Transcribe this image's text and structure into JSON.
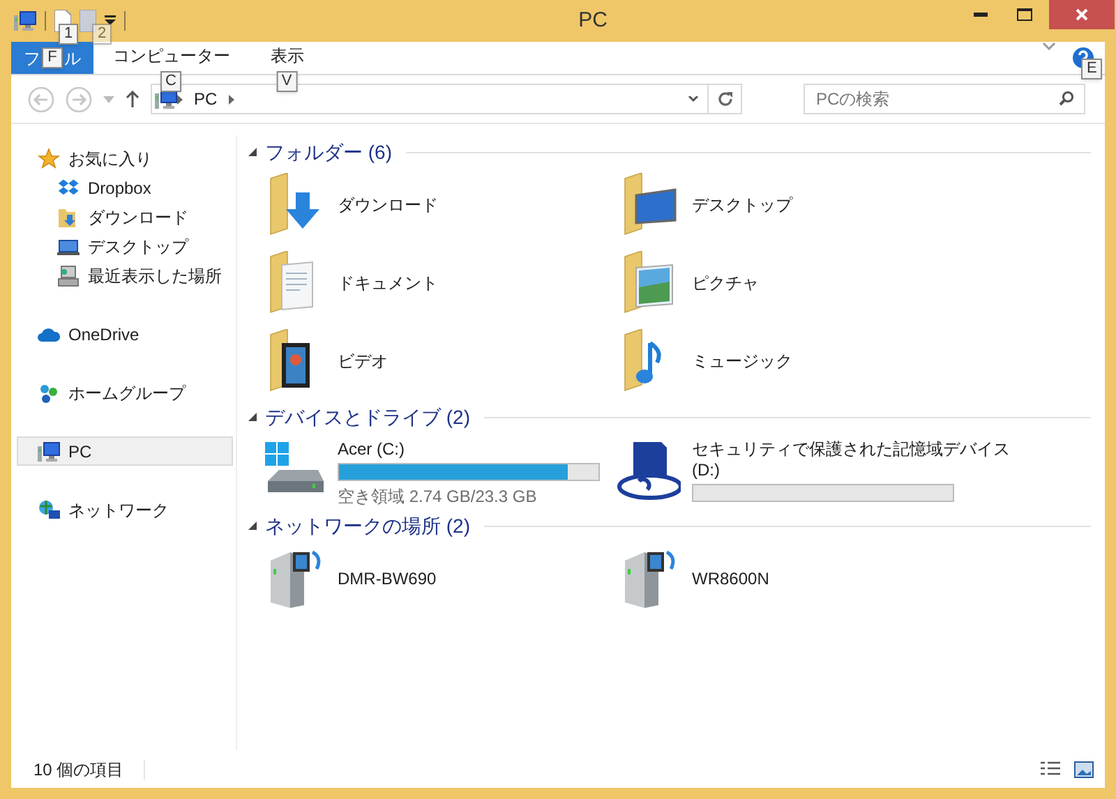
{
  "window": {
    "title": "PC"
  },
  "quick_access": {
    "keytips": [
      "1",
      "2"
    ]
  },
  "ribbon": {
    "tabs": [
      {
        "kind": "file",
        "label_start": "フ",
        "keytip": "F",
        "label_end": "ル",
        "selected": false
      },
      {
        "kind": "tab",
        "label": "コンピューター",
        "keytip": "C",
        "selected": false
      },
      {
        "kind": "tab",
        "label": "表示",
        "keytip": "V",
        "selected": false
      }
    ],
    "help_keytip": "E"
  },
  "address_bar": {
    "crumbs": [
      "PC"
    ]
  },
  "search": {
    "placeholder": "PCの検索"
  },
  "sidebar": {
    "groups": [
      {
        "label": "お気に入り",
        "selected": false,
        "children": [
          {
            "label": "Dropbox",
            "selected": false
          },
          {
            "label": "ダウンロード",
            "selected": false
          },
          {
            "label": "デスクトップ",
            "selected": false
          },
          {
            "label": "最近表示した場所",
            "selected": false
          }
        ]
      },
      {
        "label": "OneDrive",
        "selected": false
      },
      {
        "label": "ホームグループ",
        "selected": false
      },
      {
        "label": "PC",
        "selected": true
      },
      {
        "label": "ネットワーク",
        "selected": false
      }
    ]
  },
  "sections": [
    {
      "title": "フォルダー (6)",
      "expanded": true,
      "items": [
        {
          "kind": "folder",
          "label": "ダウンロード"
        },
        {
          "kind": "folder",
          "label": "デスクトップ"
        },
        {
          "kind": "folder",
          "label": "ドキュメント"
        },
        {
          "kind": "folder",
          "label": "ピクチャ"
        },
        {
          "kind": "folder",
          "label": "ビデオ"
        },
        {
          "kind": "folder",
          "label": "ミュージック"
        }
      ]
    },
    {
      "title": "デバイスとドライブ (2)",
      "expanded": true,
      "items": [
        {
          "kind": "drive",
          "label": "Acer (C:)",
          "level": 0.88,
          "free": "空き領域 2.74 GB/23.3 GB"
        },
        {
          "kind": "drive",
          "label": "セキュリティで保護された記憶域デバイス",
          "label_2": "(D:)",
          "level": 0
        }
      ]
    },
    {
      "title": "ネットワークの場所 (2)",
      "expanded": true,
      "items": [
        {
          "kind": "media",
          "label": "DMR-BW690"
        },
        {
          "kind": "media",
          "label": "WR8600N"
        }
      ]
    }
  ],
  "status_bar": {
    "text": "10 個の項目"
  }
}
